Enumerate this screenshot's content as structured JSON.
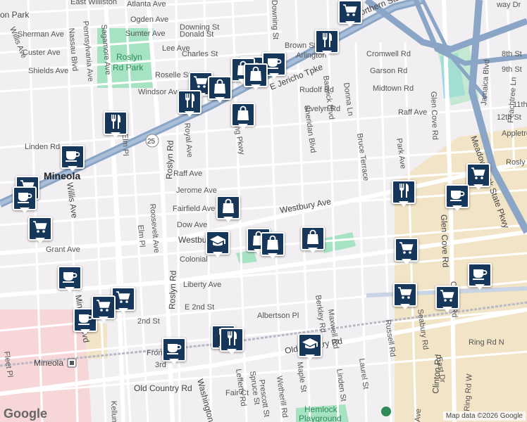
{
  "map": {
    "google_logo": "Google",
    "attribution": "Map data ©2026 Google",
    "colors": {
      "background": "#f2eff2",
      "highway": "#8aa5c6",
      "park": "#a6e3c2",
      "commercial": "#f2e4c6",
      "medical": "#f7d6d8",
      "water": "#9fd6ea",
      "pin": "#16365a"
    },
    "places": {
      "east_williston": "East Williston",
      "mineola": "Mineola",
      "mineola_station": "Mineola",
      "roslyn_rd_park_1": "Roslyn",
      "roslyn_rd_park_2": "Rd Park",
      "hemlock_1": "Hemlock",
      "hemlock_2": "Playground",
      "partial_city": "on Park"
    },
    "roads": {
      "atlanta_ave": "Atlanta Ave",
      "ogden_ave": "Ogden Ave",
      "downing_st": "Downing St",
      "donald_st": "Donald St",
      "sumter_ave": "Sumter Ave",
      "lee_ave": "Lee Ave",
      "charles_st": "Charles St",
      "brown_st": "Brown St",
      "arlington": "Arlington",
      "sherman_ave": "Sherman Ave",
      "custer_ave": "Custer Ave",
      "shields_ave": "Shields Ave",
      "willis_ave_n": "Willis Ave",
      "nassau_blvd": "Nassau Blvd",
      "pennsylvania_ave": "Pennsylvania Ave",
      "sagamore_ave": "Sagamore Ave",
      "roselle_st": "Roselle St",
      "windsor_ave": "Windsor Ave",
      "e_jericho_tpke": "E Jericho Tpke",
      "rudolf_rd": "Rudolf Rd",
      "barwick_blvd": "Barwick Blvd",
      "evelyn_rd": "Evelyn Rd",
      "donna_ln": "Donna Ln",
      "cromwell_rd": "Cromwell Rd",
      "garson_rd": "Garson Rd",
      "midtown_rd": "Midtown Rd",
      "raff_ave_e": "Raff Ave",
      "northern_state_pkwy": "Northern State Pkwy",
      "glen_cove_rd_n": "Glen Cove Rd",
      "jamaica_blvd": "Jamaica Blvd",
      "peachtree_ln": "Peachtree Ln",
      "eighth_st": "8th St",
      "ninth_st": "9th St",
      "eleventh_st": "11th St",
      "twelfth_st": "12th St",
      "appletree": "Appletree",
      "roslyn_partial": "Rosly",
      "meadowbrook_pkwy": "Meadowbrook State Pkwy",
      "linden_rd": "Linden Rd",
      "elm_pl_n": "Elm Pl",
      "roslyn_rd_n": "Roslyn Rd",
      "royal_ave": "Royal Ave",
      "manning_pkwy": "Manning Pkwy",
      "sheridan_blvd": "Sheridan Blvd",
      "bruce_terrace": "Bruce Terrace",
      "park_ave": "Park Ave",
      "route_25": "25",
      "raff_ave_w": "Raff Ave",
      "jerome_ave": "Jerome Ave",
      "fairfield_ave": "Fairfield Ave",
      "dow_ave": "Dow Ave",
      "westbury_ave": "Westbury Ave",
      "willis_ave_s": "Willis Ave",
      "roosevelt_ave": "Roosevelt Ave",
      "elm_pl_s": "Elm Pl",
      "grant_ave": "Grant Ave",
      "colonial": "Colonial",
      "liberty": "Liberty Ave",
      "glen_cove_rd_s": "Glen Cove Rd",
      "e_2nd_st": "E 2nd St",
      "second_st": "2nd St",
      "albertson_pl": "Albertson Pl",
      "berkley_rd": "Berkley Rd",
      "maxwell_rd": "Maxwell Rd",
      "russell_rd": "Russell Rd",
      "seabury_rd": "Seabury Rd",
      "clinton_rd_n": "Clinton Rd",
      "ring_rd": "Ring Rd N",
      "front": "Front St",
      "third": "3rd",
      "old_country_rd_w": "Old Country Rd",
      "old_country_rd_e": "Old Country Rd",
      "mineola_blvd": "Mineola Blvd",
      "washington": "Washington",
      "linden_st": "Linden St",
      "laurel_st": "Laurel St",
      "maple_st": "Maple St",
      "wetherill_rd": "Wetherill Rd",
      "prescott_st": "Prescott St",
      "spruce_st": "Spruce St",
      "lefferts_rd": "Lefferts Rd",
      "fair_ct": "Fair Ct",
      "kellum": "Kellum",
      "fleet_pl": "Fleet Pl",
      "east_dr": "East Dr",
      "clinton_rd_s": "Clinton Rd",
      "ring_rd_w": "Ring Rd W",
      "way_dr": "way Dr",
      "ave_partial": "Ave",
      "roslyn_rd_s": "Roslyn Rd"
    },
    "markers": [
      {
        "icon": "grocery-cart"
      },
      {
        "icon": "restaurant"
      },
      {
        "icon": "cafe"
      },
      {
        "icon": "grocery-cart"
      },
      {
        "icon": "shopping-bag"
      },
      {
        "icon": "shopping-bag"
      },
      {
        "icon": "grocery-cart"
      },
      {
        "icon": "restaurant"
      },
      {
        "icon": "shopping-bag"
      },
      {
        "icon": "shopping-bag"
      },
      {
        "icon": "restaurant"
      },
      {
        "icon": "cafe"
      },
      {
        "icon": "grocery-cart"
      },
      {
        "icon": "cafe"
      },
      {
        "icon": "grocery-cart"
      },
      {
        "icon": "grocery-cart"
      },
      {
        "icon": "school"
      },
      {
        "icon": "shopping-bag"
      },
      {
        "icon": "shopping-bag"
      },
      {
        "icon": "shopping-bag"
      },
      {
        "icon": "shopping-bag"
      },
      {
        "icon": "restaurant"
      },
      {
        "icon": "cafe"
      },
      {
        "icon": "grocery-cart"
      },
      {
        "icon": "grocery-cart"
      },
      {
        "icon": "cafe"
      },
      {
        "icon": "grocery-cart"
      },
      {
        "icon": "grocery-cart"
      },
      {
        "icon": "cafe"
      },
      {
        "icon": "cafe"
      },
      {
        "icon": "restaurant"
      },
      {
        "icon": "restaurant"
      },
      {
        "icon": "cafe"
      },
      {
        "icon": "school"
      },
      {
        "icon": "grocery-cart"
      }
    ]
  }
}
